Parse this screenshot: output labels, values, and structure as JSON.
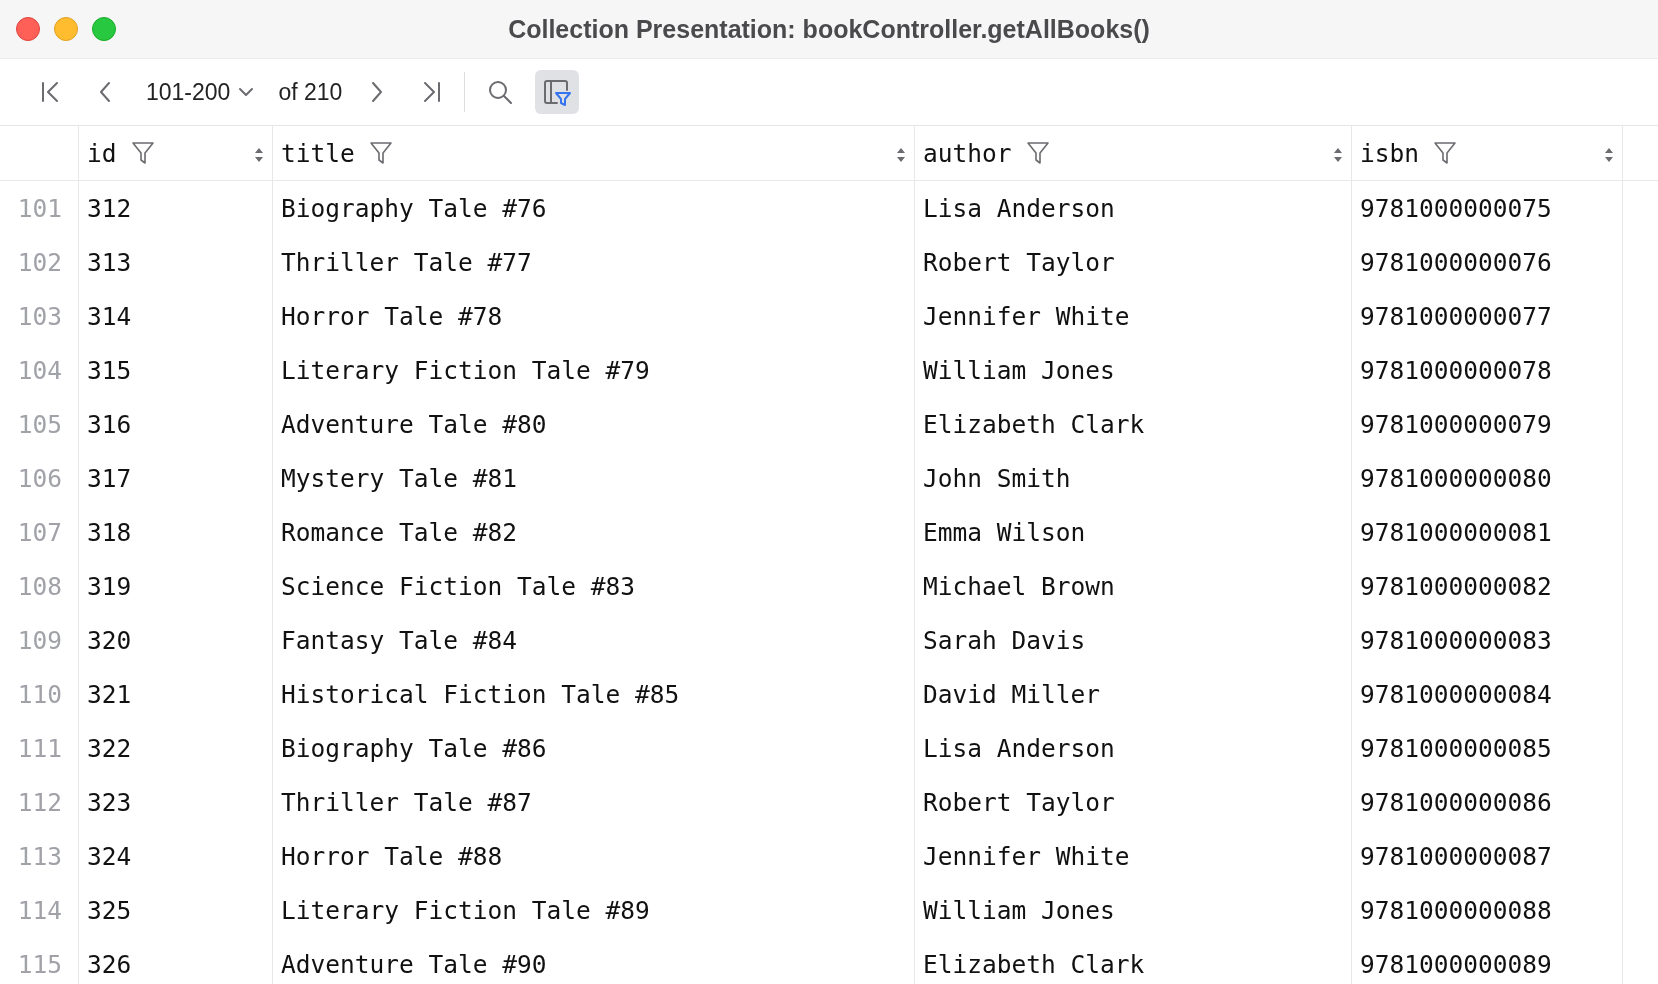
{
  "window": {
    "title": "Collection Presentation: bookController.getAllBooks()"
  },
  "toolbar": {
    "page_range": "101-200",
    "page_total": "of 210",
    "filter_toggle": {
      "on": true
    }
  },
  "table": {
    "columns": [
      {
        "label": "id"
      },
      {
        "label": "title"
      },
      {
        "label": "author"
      },
      {
        "label": "isbn"
      }
    ],
    "rows": [
      {
        "number": "101",
        "cells": [
          "312",
          "Biography Tale #76",
          "Lisa Anderson",
          "9781000000075"
        ]
      },
      {
        "number": "102",
        "cells": [
          "313",
          "Thriller Tale #77",
          "Robert Taylor",
          "9781000000076"
        ]
      },
      {
        "number": "103",
        "cells": [
          "314",
          "Horror Tale #78",
          "Jennifer White",
          "9781000000077"
        ]
      },
      {
        "number": "104",
        "cells": [
          "315",
          "Literary Fiction Tale #79",
          "William Jones",
          "9781000000078"
        ]
      },
      {
        "number": "105",
        "cells": [
          "316",
          "Adventure Tale #80",
          "Elizabeth Clark",
          "9781000000079"
        ]
      },
      {
        "number": "106",
        "cells": [
          "317",
          "Mystery Tale #81",
          "John Smith",
          "9781000000080"
        ]
      },
      {
        "number": "107",
        "cells": [
          "318",
          "Romance Tale #82",
          "Emma Wilson",
          "9781000000081"
        ]
      },
      {
        "number": "108",
        "cells": [
          "319",
          "Science Fiction Tale #83",
          "Michael Brown",
          "9781000000082"
        ]
      },
      {
        "number": "109",
        "cells": [
          "320",
          "Fantasy Tale #84",
          "Sarah Davis",
          "9781000000083"
        ]
      },
      {
        "number": "110",
        "cells": [
          "321",
          "Historical Fiction Tale #85",
          "David Miller",
          "9781000000084"
        ]
      },
      {
        "number": "111",
        "cells": [
          "322",
          "Biography Tale #86",
          "Lisa Anderson",
          "9781000000085"
        ]
      },
      {
        "number": "112",
        "cells": [
          "323",
          "Thriller Tale #87",
          "Robert Taylor",
          "9781000000086"
        ]
      },
      {
        "number": "113",
        "cells": [
          "324",
          "Horror Tale #88",
          "Jennifer White",
          "9781000000087"
        ]
      },
      {
        "number": "114",
        "cells": [
          "325",
          "Literary Fiction Tale #89",
          "William Jones",
          "9781000000088"
        ]
      },
      {
        "number": "115",
        "cells": [
          "326",
          "Adventure Tale #90",
          "Elizabeth Clark",
          "9781000000089"
        ]
      }
    ]
  }
}
